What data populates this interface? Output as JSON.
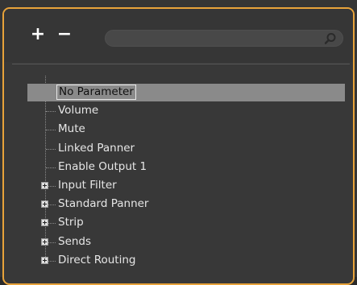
{
  "toolbar": {
    "add_label": "+",
    "remove_label": "−"
  },
  "search": {
    "value": "",
    "placeholder": ""
  },
  "tree": {
    "items": [
      {
        "label": "No Parameter",
        "selected": true,
        "expandable": false
      },
      {
        "label": "Volume",
        "selected": false,
        "expandable": false
      },
      {
        "label": "Mute",
        "selected": false,
        "expandable": false
      },
      {
        "label": "Linked Panner",
        "selected": false,
        "expandable": false
      },
      {
        "label": "Enable Output 1",
        "selected": false,
        "expandable": false
      },
      {
        "label": "Input Filter",
        "selected": false,
        "expandable": true
      },
      {
        "label": "Standard Panner",
        "selected": false,
        "expandable": true
      },
      {
        "label": "Strip",
        "selected": false,
        "expandable": true
      },
      {
        "label": "Sends",
        "selected": false,
        "expandable": true
      },
      {
        "label": "Direct Routing",
        "selected": false,
        "expandable": true
      }
    ]
  },
  "colors": {
    "accent_border": "#e8a33a",
    "background": "#383838",
    "selection": "#8a8a8a"
  },
  "icons": {
    "search": "search-icon",
    "expander": "plus-box-icon"
  }
}
